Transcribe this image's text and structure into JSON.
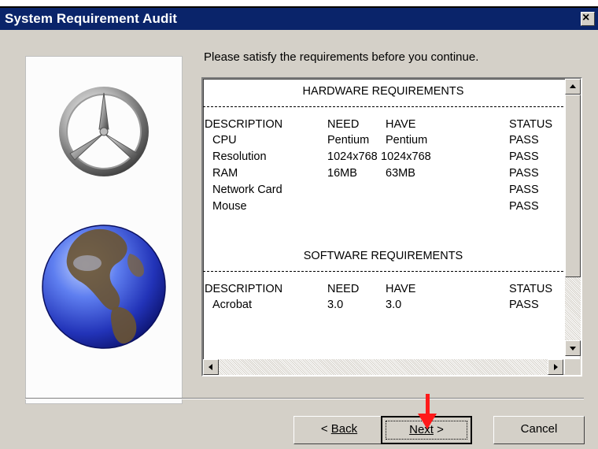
{
  "window": {
    "title": "System Requirement Audit",
    "close_glyph": "×"
  },
  "instruction": "Please satisfy the requirements before you continue.",
  "hardware": {
    "heading": "HARDWARE REQUIREMENTS",
    "columns": [
      "DESCRIPTION",
      "NEED",
      "HAVE",
      "STATUS"
    ],
    "rows": [
      {
        "description": "CPU",
        "need": "Pentium",
        "have": "Pentium",
        "status": "PASS"
      },
      {
        "description": "Resolution",
        "need": "1024x768",
        "have": "1024x768",
        "status": "PASS"
      },
      {
        "description": "RAM",
        "need": "16MB",
        "have": "63MB",
        "status": "PASS"
      },
      {
        "description": "Network Card",
        "need": "",
        "have": "",
        "status": "PASS"
      },
      {
        "description": "Mouse",
        "need": "",
        "have": "",
        "status": "PASS"
      }
    ]
  },
  "software": {
    "heading": "SOFTWARE REQUIREMENTS",
    "columns": [
      "DESCRIPTION",
      "NEED",
      "HAVE",
      "STATUS"
    ],
    "rows": [
      {
        "description": "Acrobat",
        "need": "3.0",
        "have": "3.0",
        "status": "PASS"
      }
    ]
  },
  "buttons": {
    "back": "Back",
    "next": "Next",
    "cancel": "Cancel"
  },
  "icons": [
    "mercedes-logo-icon",
    "globe-icon",
    "red-arrow-icon"
  ],
  "colors": {
    "titlebar": "#0a246a",
    "face": "#d4d0c8",
    "arrow": "#ff1a1a"
  }
}
